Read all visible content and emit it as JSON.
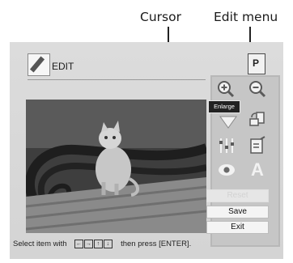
{
  "callouts": {
    "cursor": "Cursor",
    "edit_menu": "Edit menu"
  },
  "screen": {
    "title": "EDIT",
    "corner_icon": {
      "letter": "P",
      "icon": "print-icon"
    },
    "photo": {
      "subject": "cat-on-bench-photo"
    },
    "menu": {
      "icons": [
        "zoom-in-icon",
        "zoom-out-icon",
        "move-icon",
        "rotate-icon",
        "adjust-icon",
        "frame-icon",
        "red-eye-icon",
        "text-icon"
      ],
      "tooltip": "Enlarge",
      "reset_label": "Reset",
      "save_label": "Save",
      "exit_label": "Exit"
    },
    "status": {
      "text_before": "Select item with",
      "keys": [
        "←",
        "→",
        "↑",
        "↓"
      ],
      "text_after": "then press [ENTER]."
    }
  },
  "colors": {
    "panel": "#d4d4d4",
    "menu": "#c6c6c6",
    "tooltip": "#222222"
  }
}
